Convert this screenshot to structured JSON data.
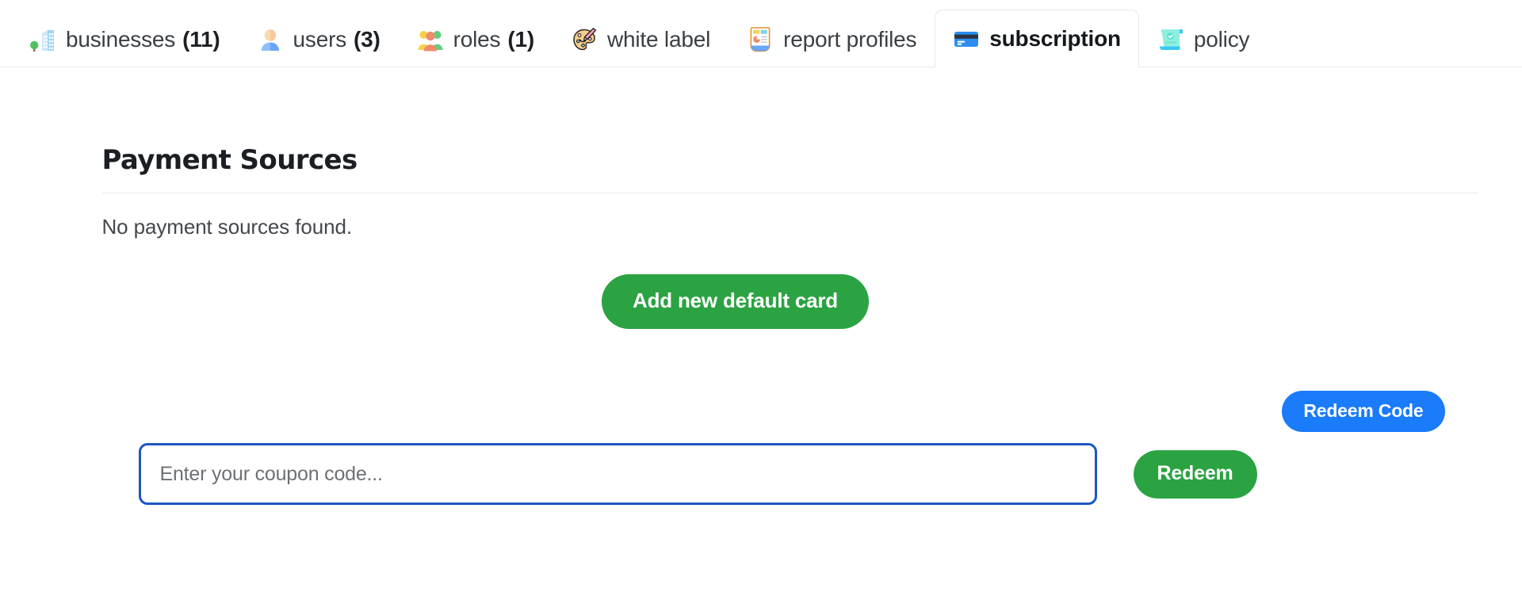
{
  "tabs": [
    {
      "id": "businesses",
      "label": "businesses",
      "count": "(11)",
      "icon": "office-buildings-icon",
      "active": false
    },
    {
      "id": "users",
      "label": "users",
      "count": "(3)",
      "icon": "user-bust-icon",
      "active": false
    },
    {
      "id": "roles",
      "label": "roles",
      "count": "(1)",
      "icon": "people-group-icon",
      "active": false
    },
    {
      "id": "white-label",
      "label": "white label",
      "count": "",
      "icon": "artist-palette-icon",
      "active": false
    },
    {
      "id": "report-profiles",
      "label": "report profiles",
      "count": "",
      "icon": "report-chart-icon",
      "active": false
    },
    {
      "id": "subscription",
      "label": "subscription",
      "count": "",
      "icon": "credit-card-icon",
      "active": true
    },
    {
      "id": "policy",
      "label": "policy",
      "count": "",
      "icon": "policy-scroll-icon",
      "active": false
    }
  ],
  "payment_sources": {
    "title": "Payment Sources",
    "empty_message": "No payment sources found.",
    "add_card_label": "Add new default card"
  },
  "coupon": {
    "redeem_code_label": "Redeem Code",
    "placeholder": "Enter your coupon code...",
    "value": "",
    "redeem_label": "Redeem"
  },
  "colors": {
    "green": "#2ba342",
    "blue": "#1a7bfb",
    "input_border_blue": "#1d56c4",
    "tab_border": "#e6e8ea",
    "divider": "#e9eaec",
    "text": "#2b2f33"
  }
}
